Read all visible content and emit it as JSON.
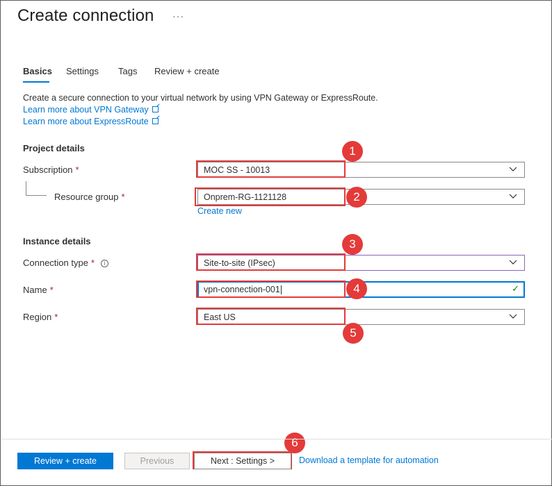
{
  "page": {
    "title": "Create connection",
    "more_label": "···"
  },
  "tabs": [
    {
      "label": "Basics",
      "active": true
    },
    {
      "label": "Settings",
      "active": false
    },
    {
      "label": "Tags",
      "active": false
    },
    {
      "label": "Review + create",
      "active": false
    }
  ],
  "intro": {
    "description": "Create a secure connection to your virtual network by using VPN Gateway or ExpressRoute.",
    "link_vpn": "Learn more about VPN Gateway",
    "link_expressroute": "Learn more about ExpressRoute"
  },
  "project_details": {
    "heading": "Project details",
    "subscription": {
      "label": "Subscription",
      "value": "MOC SS - 10013",
      "required": "*"
    },
    "resource_group": {
      "label": "Resource group",
      "value": "Onprem-RG-1121128",
      "required": "*"
    },
    "create_new": "Create new"
  },
  "instance_details": {
    "heading": "Instance details",
    "connection_type": {
      "label": "Connection type",
      "value": "Site-to-site (IPsec)",
      "required": "*",
      "info_icon": "ⓘ"
    },
    "name": {
      "label": "Name",
      "value": "vpn-connection-001",
      "required": "*"
    },
    "region": {
      "label": "Region",
      "value": "East US",
      "required": "*"
    }
  },
  "annotations": [
    "1",
    "2",
    "3",
    "4",
    "5",
    "6"
  ],
  "footer": {
    "review_create": "Review + create",
    "previous": "Previous",
    "next": "Next : Settings >",
    "download": "Download a template for automation"
  },
  "colors": {
    "accent": "#0078d4",
    "highlight": "#e43a3a",
    "required": "#a4262c",
    "valid": "#107c10"
  }
}
